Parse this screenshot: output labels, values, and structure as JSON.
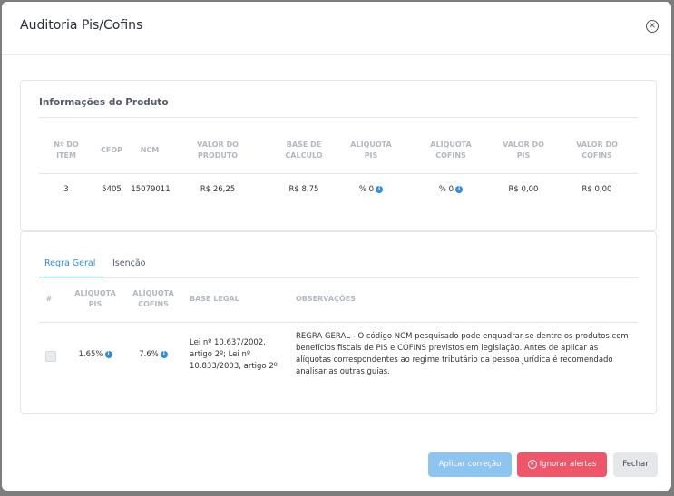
{
  "modal": {
    "title": "Auditoria Pis/Cofins"
  },
  "product_info": {
    "title": "Informações do Produto",
    "headers": [
      [
        "Nº DO",
        "ITEM"
      ],
      [
        "CFOP"
      ],
      [
        "NCM"
      ],
      [
        "VALOR DO",
        "PRODUTO"
      ],
      [
        "BASE DE",
        "CÁLCULO"
      ],
      [
        "ALÍQUOTA",
        "PIS"
      ],
      [
        "ALÍQUOTA",
        "COFINS"
      ],
      [
        "VALOR DO",
        "PIS"
      ],
      [
        "VALOR DO",
        "COFINS"
      ]
    ],
    "row": {
      "item": "3",
      "cfop": "5405",
      "ncm": "15079011",
      "valor_produto": "R$ 26,25",
      "base_calculo": "R$ 8,75",
      "aliquota_pis": "% 0",
      "aliquota_cofins": "% 0",
      "valor_pis": "R$ 0,00",
      "valor_cofins": "R$ 0,00"
    }
  },
  "rules": {
    "tabs": [
      "Regra Geral",
      "Isenção"
    ],
    "headers": {
      "num": "#",
      "aliq_pis": [
        "ALÍQUOTA",
        "PIS"
      ],
      "aliq_cofins": [
        "ALÍQUOTA",
        "COFINS"
      ],
      "base_legal": "BASE LEGAL",
      "observacoes": "OBSERVAÇÕES"
    },
    "row": {
      "aliquota_pis": "1.65%",
      "aliquota_cofins": "7.6%",
      "base_legal": "Lei nº 10.637/2002, artigo 2º; Lei nº 10.833/2003, artigo 2º",
      "observacoes": "REGRA GERAL - O código NCM pesquisado pode enquadrar-se dentre os produtos com benefícios fiscais de PIS e COFINS previstos em legislação. Antes de aplicar as alíquotas correspondentes ao regime tributário da pessoa jurídica é recomendado analisar as outras guias."
    }
  },
  "footer": {
    "apply": "Aplicar correção",
    "ignore": "Ignorar alertas",
    "close": "Fechar"
  },
  "colors": {
    "primary": "#2d8fe0",
    "danger": "#f0566a",
    "apply_disabled": "#8ec4f0"
  },
  "icons": {
    "close": "close-circle-icon",
    "info": "info-icon",
    "ignore": "x-circle-icon"
  }
}
